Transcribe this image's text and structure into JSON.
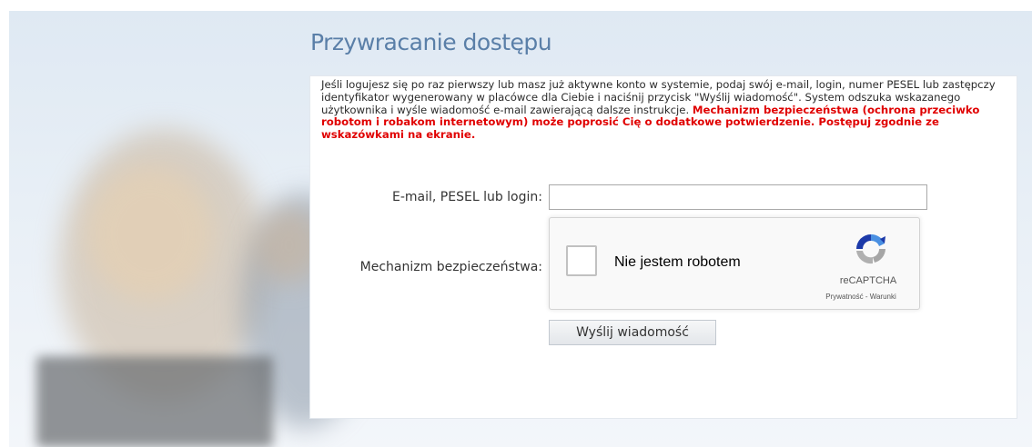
{
  "page": {
    "title": "Przywracanie dostępu"
  },
  "info": {
    "text": "Jeśli logujesz się po raz pierwszy lub masz już aktywne konto w systemie, podaj swój e-mail, login, numer PESEL lub zastępczy identyfikator wygenerowany w placówce dla Ciebie i naciśnij przycisk \"Wyślij wiadomość\". System odszuka wskazanego użytkownika i wyśle wiadomość e-mail zawierającą dalsze instrukcje.",
    "warning": "Mechanizm bezpieczeństwa (ochrona przeciwko robotom i robakom internetowym) może poprosić Cię o dodatkowe potwierdzenie. Postępuj zgodnie ze wskazówkami na ekranie."
  },
  "form": {
    "email_label": "E-mail, PESEL lub login:",
    "email_value": "",
    "security_label": "Mechanizm bezpieczeństwa:",
    "submit_label": "Wyślij wiadomość"
  },
  "captcha": {
    "checkbox_label": "Nie jestem robotem",
    "brand": "reCAPTCHA",
    "links": "Prywatność - Warunki",
    "checked": false
  },
  "colors": {
    "title": "#5a7fa8",
    "warning": "#e00000"
  }
}
